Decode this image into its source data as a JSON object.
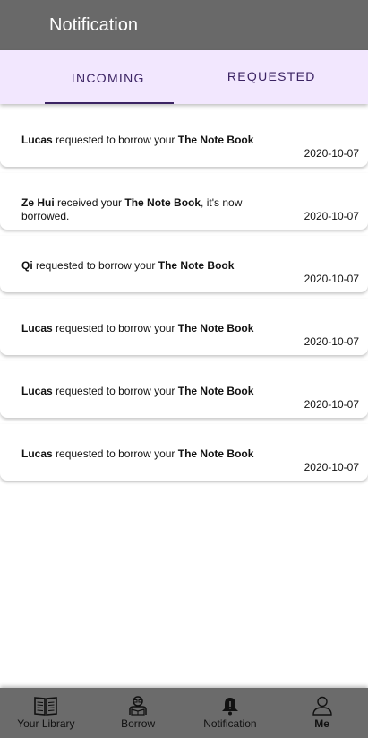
{
  "header": {
    "title": "Notification"
  },
  "tabs": [
    {
      "label": "INCOMING",
      "active": true
    },
    {
      "label": "REQUESTED",
      "active": false
    }
  ],
  "notifications": [
    {
      "user": "Lucas",
      "text": " requested to borrow your ",
      "book": "The Note Book",
      "suffix": "",
      "date": "2020-10-07"
    },
    {
      "user": "Ze Hui",
      "text": " received your ",
      "book": "The Note Book",
      "suffix": ", it's now borrowed.",
      "date": "2020-10-07"
    },
    {
      "user": "Qi",
      "text": " requested to borrow your ",
      "book": "The Note Book",
      "suffix": "",
      "date": "2020-10-07"
    },
    {
      "user": "Lucas",
      "text": " requested to borrow your ",
      "book": "The Note Book",
      "suffix": "",
      "date": "2020-10-07"
    },
    {
      "user": "Lucas",
      "text": " requested to borrow your ",
      "book": "The Note Book",
      "suffix": "",
      "date": "2020-10-07"
    },
    {
      "user": "Lucas",
      "text": " requested to borrow your ",
      "book": "The Note Book",
      "suffix": "",
      "date": "2020-10-07"
    }
  ],
  "bottom_nav": [
    {
      "label": "Your Library",
      "icon": "book-icon"
    },
    {
      "label": "Borrow",
      "icon": "reader-icon"
    },
    {
      "label": "Notification",
      "icon": "bell-icon"
    },
    {
      "label": "Me",
      "icon": "person-icon"
    }
  ],
  "colors": {
    "appbar": "#696969",
    "tab_bg": "#f2e7fe",
    "tab_text": "#3b2363",
    "bottom_bar": "#6b6b6b"
  }
}
